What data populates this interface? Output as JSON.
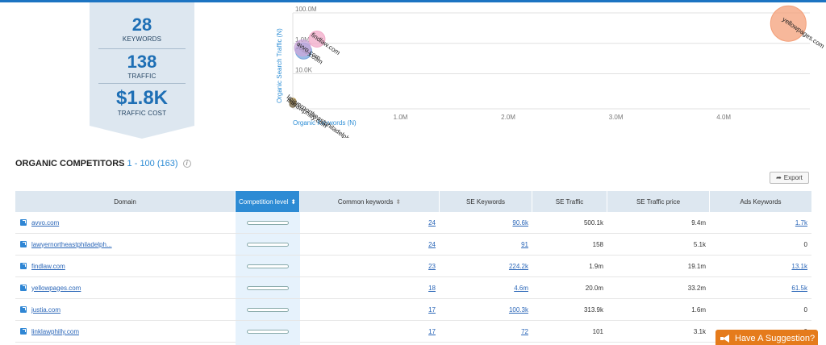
{
  "summary": {
    "keywords_value": "28",
    "keywords_label": "KEYWORDS",
    "traffic_value": "138",
    "traffic_label": "TRAFFIC",
    "cost_value": "$1.8K",
    "cost_label": "TRAFFIC COST"
  },
  "chart_data": {
    "type": "scatter",
    "xlabel": "Organic Keywords (N)",
    "ylabel": "Organic Search Traffic (N)",
    "x_ticks": [
      "1.0M",
      "2.0M",
      "3.0M",
      "4.0M"
    ],
    "y_ticks": [
      "100.0M",
      "1.0M",
      "10.0K"
    ],
    "y_scale": "log",
    "points": [
      {
        "label": "yellowpages.com",
        "x": 4600000,
        "y": 20000000,
        "color": "#f4a07a"
      },
      {
        "label": "findlaw.com",
        "x": 224200,
        "y": 1900000,
        "color": "#f2a9c8"
      },
      {
        "label": "justia.com",
        "x": 100300,
        "y": 313900,
        "color": "#7aa6dc"
      },
      {
        "label": "avvo.com",
        "x": 90600,
        "y": 500100,
        "color": "#c9a7d9"
      },
      {
        "label": "lawyernortheastphiladelph...",
        "x": 91,
        "y": 158,
        "color": "#b59a5a"
      },
      {
        "label": "linklawphilly.com",
        "x": 72,
        "y": 101,
        "color": "#7a6a4a"
      }
    ]
  },
  "section": {
    "title": "ORGANIC COMPETITORS",
    "range": "1 - 100 (163)",
    "info": "i",
    "export_label": "Export"
  },
  "table": {
    "headers": [
      "Domain",
      "Competition level",
      "Common keywords",
      "SE Keywords",
      "SE Traffic",
      "SE Traffic price",
      "Ads Keywords"
    ],
    "rows": [
      {
        "domain": "avvo.com",
        "competition": 0.05,
        "common": "24",
        "se_keywords": "90.6k",
        "se_traffic": "500.1k",
        "se_traffic_price": "9.4m",
        "ads": "1.7k",
        "ads_link": true
      },
      {
        "domain": "lawyernortheastphiladelph...",
        "competition": 0.05,
        "common": "24",
        "se_keywords": "91",
        "se_traffic": "158",
        "se_traffic_price": "5.1k",
        "ads": "0",
        "ads_link": false
      },
      {
        "domain": "findlaw.com",
        "competition": 0.05,
        "common": "23",
        "se_keywords": "224.2k",
        "se_traffic": "1.9m",
        "se_traffic_price": "19.1m",
        "ads": "13.1k",
        "ads_link": true
      },
      {
        "domain": "yellowpages.com",
        "competition": 0.05,
        "common": "18",
        "se_keywords": "4.6m",
        "se_traffic": "20.0m",
        "se_traffic_price": "33.2m",
        "ads": "61.5k",
        "ads_link": true
      },
      {
        "domain": "justia.com",
        "competition": 0.05,
        "common": "17",
        "se_keywords": "100.3k",
        "se_traffic": "313.9k",
        "se_traffic_price": "1.6m",
        "ads": "0",
        "ads_link": false
      },
      {
        "domain": "linklawphilly.com",
        "competition": 0.05,
        "common": "17",
        "se_keywords": "72",
        "se_traffic": "101",
        "se_traffic_price": "3.1k",
        "ads": "0",
        "ads_link": false
      }
    ]
  },
  "suggestion": {
    "label": "Have A Suggestion?"
  },
  "colors": {
    "accent": "#2d8bd4",
    "suggest": "#e57b1b",
    "panel": "#dde7f0"
  }
}
